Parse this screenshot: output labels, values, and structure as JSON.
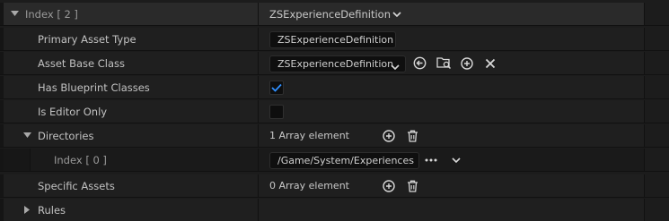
{
  "index_header": {
    "label": "Index [ 2 ]",
    "value": "ZSExperienceDefinition",
    "icons": [
      "expand-arrow-icon",
      "chevron-down-icon"
    ]
  },
  "properties": [
    {
      "label": "Primary Asset Type",
      "value": "ZSExperienceDefinition"
    },
    {
      "label": "Asset Base Class",
      "value": "ZSExperienceDefinition",
      "icons": [
        "chevron-down-icon",
        "use-selected-icon",
        "browse-icon",
        "add-icon",
        "clear-icon"
      ]
    },
    {
      "label": "Has Blueprint Classes",
      "checked": true
    },
    {
      "label": "Is Editor Only",
      "checked": false
    },
    {
      "label": "Directories",
      "value": "1 Array element",
      "icons": [
        "collapse-arrow-icon",
        "add-icon",
        "delete-icon"
      ]
    },
    {
      "label": "Index [ 0 ]",
      "value": "/Game/System/Experiences",
      "icons": [
        "more-options-icon",
        "chevron-down-icon"
      ]
    },
    {
      "label": "Specific Assets",
      "value": "0 Array element",
      "icons": [
        "add-icon",
        "delete-icon"
      ]
    },
    {
      "label": "Rules",
      "icons": [
        "expand-arrow-icon"
      ]
    }
  ],
  "colors": {
    "checkmark": "#2f8fff",
    "icon": "#d8d8d8"
  }
}
